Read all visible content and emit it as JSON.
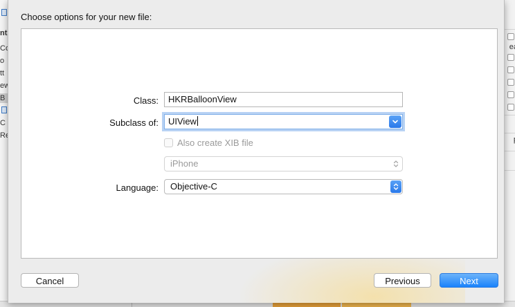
{
  "sheet": {
    "title": "Choose options for your new file:"
  },
  "form": {
    "class_label": "Class:",
    "class_value": "HKRBalloonView",
    "subclass_label": "Subclass of:",
    "subclass_value": "UIView",
    "xib_checkbox_label": "Also create XIB file",
    "xib_checked": false,
    "device_value": "iPhone",
    "language_label": "Language:",
    "language_value": "Objective-C"
  },
  "buttons": {
    "cancel": "Cancel",
    "previous": "Previous",
    "next": "Next"
  },
  "background": {
    "left_fragments": [
      "nt",
      "Co",
      "o",
      "tt",
      "ew",
      "B",
      "C",
      "Re"
    ],
    "right_fragments": [
      "ea",
      "p"
    ]
  },
  "colors": {
    "accent": "#2a79ea",
    "primary_button": "#1a82fb"
  }
}
